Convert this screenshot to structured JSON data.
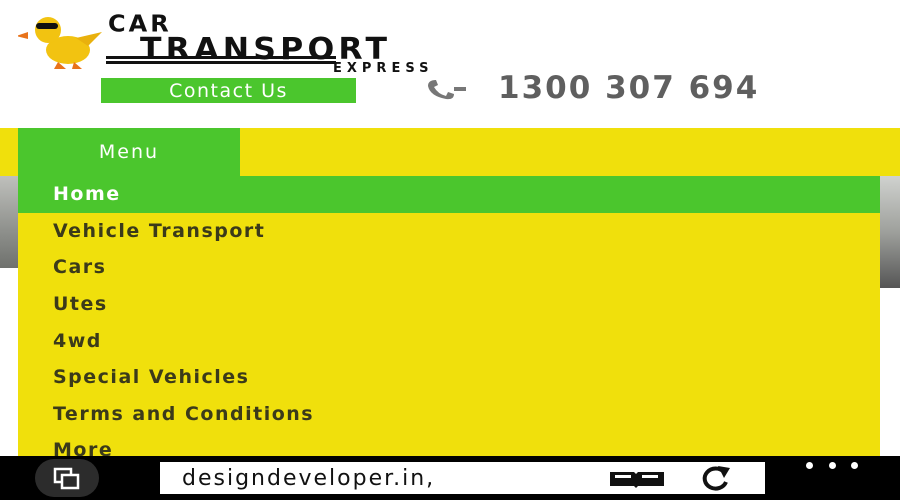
{
  "header": {
    "logo": {
      "line1": "CAR",
      "line2": "TRANSPORT",
      "line3": "EXPRESS"
    },
    "contact_button": "Contact Us",
    "phone_number": "1300 307 694"
  },
  "nav": {
    "menu_label": "Menu",
    "items": [
      {
        "label": "Home",
        "active": true
      },
      {
        "label": "Vehicle Transport",
        "active": false
      },
      {
        "label": "Cars",
        "active": false
      },
      {
        "label": "Utes",
        "active": false
      },
      {
        "label": "4wd",
        "active": false
      },
      {
        "label": "Special Vehicles",
        "active": false
      },
      {
        "label": "Terms and Conditions",
        "active": false
      },
      {
        "label": "More",
        "active": false
      }
    ]
  },
  "browser": {
    "address": "designdeveloper.in,"
  },
  "icons": {
    "phone": "phone-icon",
    "tabs": "tabs-icon",
    "reader": "reading-view-icon",
    "refresh": "refresh-icon",
    "more": "more-dots-icon"
  },
  "colors": {
    "accent_green": "#4bc62d",
    "nav_yellow": "#f0e00c",
    "phone_gray": "#5f5f5f"
  }
}
